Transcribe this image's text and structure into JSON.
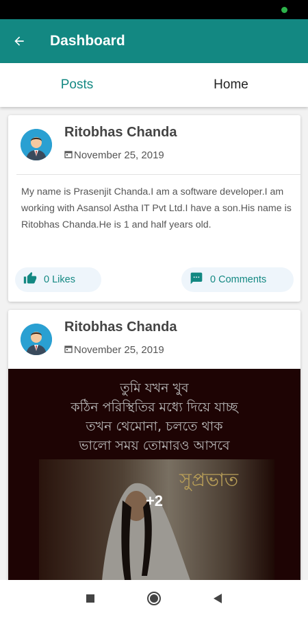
{
  "app_bar": {
    "title": "Dashboard",
    "back_icon": "arrow-back-icon"
  },
  "tabs": [
    {
      "label": "Posts",
      "active": true
    },
    {
      "label": "Home",
      "active": false
    }
  ],
  "posts": [
    {
      "author": "Ritobhas Chanda",
      "date": "November 25, 2019",
      "text": "My name is Prasenjit Chanda.I am a software developer.I am working with Asansol Astha IT Pvt Ltd.I have a son.His name is Ritobhas Chanda.He is 1 and half years old.",
      "likes_label": "0 Likes",
      "comments_label": "0 Comments"
    },
    {
      "author": "Ritobhas Chanda",
      "date": "November 25, 2019",
      "image_text": [
        "তুমি যখন খুব",
        "কঠিন পরিস্থিতির মধ্যে দিয়ে যাচ্ছ",
        "তখন থেমোনা, চলতে থাক",
        "ভালো সময় তোমারও আসবে"
      ],
      "image_caption": "সুপ্রভাত",
      "more_images": "+2"
    }
  ],
  "colors": {
    "primary": "#138882",
    "status_bar": "#000000",
    "pill_bg": "#eef5fb"
  },
  "nav": {
    "icons": [
      "square-icon",
      "circle-home-icon",
      "triangle-back-icon"
    ]
  }
}
